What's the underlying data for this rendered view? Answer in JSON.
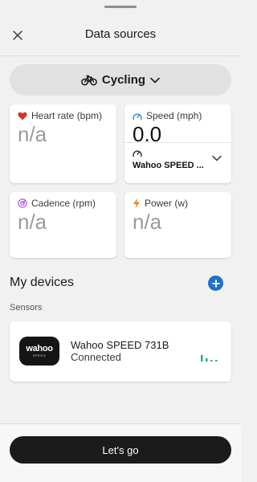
{
  "header": {
    "title": "Data sources"
  },
  "sport": {
    "label": "Cycling",
    "icon": "bicycle-icon"
  },
  "metrics": {
    "heart_rate": {
      "label": "Heart rate (bpm)",
      "value": "n/a",
      "icon_color": "#d9312b"
    },
    "speed": {
      "label": "Speed (mph)",
      "value": "0.0",
      "sensor": "Wahoo SPEED ...",
      "icon_color": "#2a8bd6"
    },
    "cadence": {
      "label": "Cadence (rpm)",
      "value": "n/a",
      "icon_color": "#b25bd6"
    },
    "power": {
      "label": "Power (w)",
      "value": "n/a",
      "icon_color": "#f08a1a"
    }
  },
  "devices": {
    "title": "My devices",
    "sensors_label": "Sensors",
    "items": [
      {
        "logo": "wahoo",
        "logo_sub": "SPEED",
        "name": "Wahoo SPEED 731B",
        "status": "Connected",
        "signal_color": "#22b573"
      }
    ]
  },
  "footer": {
    "cta_label": "Let's go"
  },
  "colors": {
    "accent": "#1f72c6",
    "button": "#1b1b1b"
  }
}
